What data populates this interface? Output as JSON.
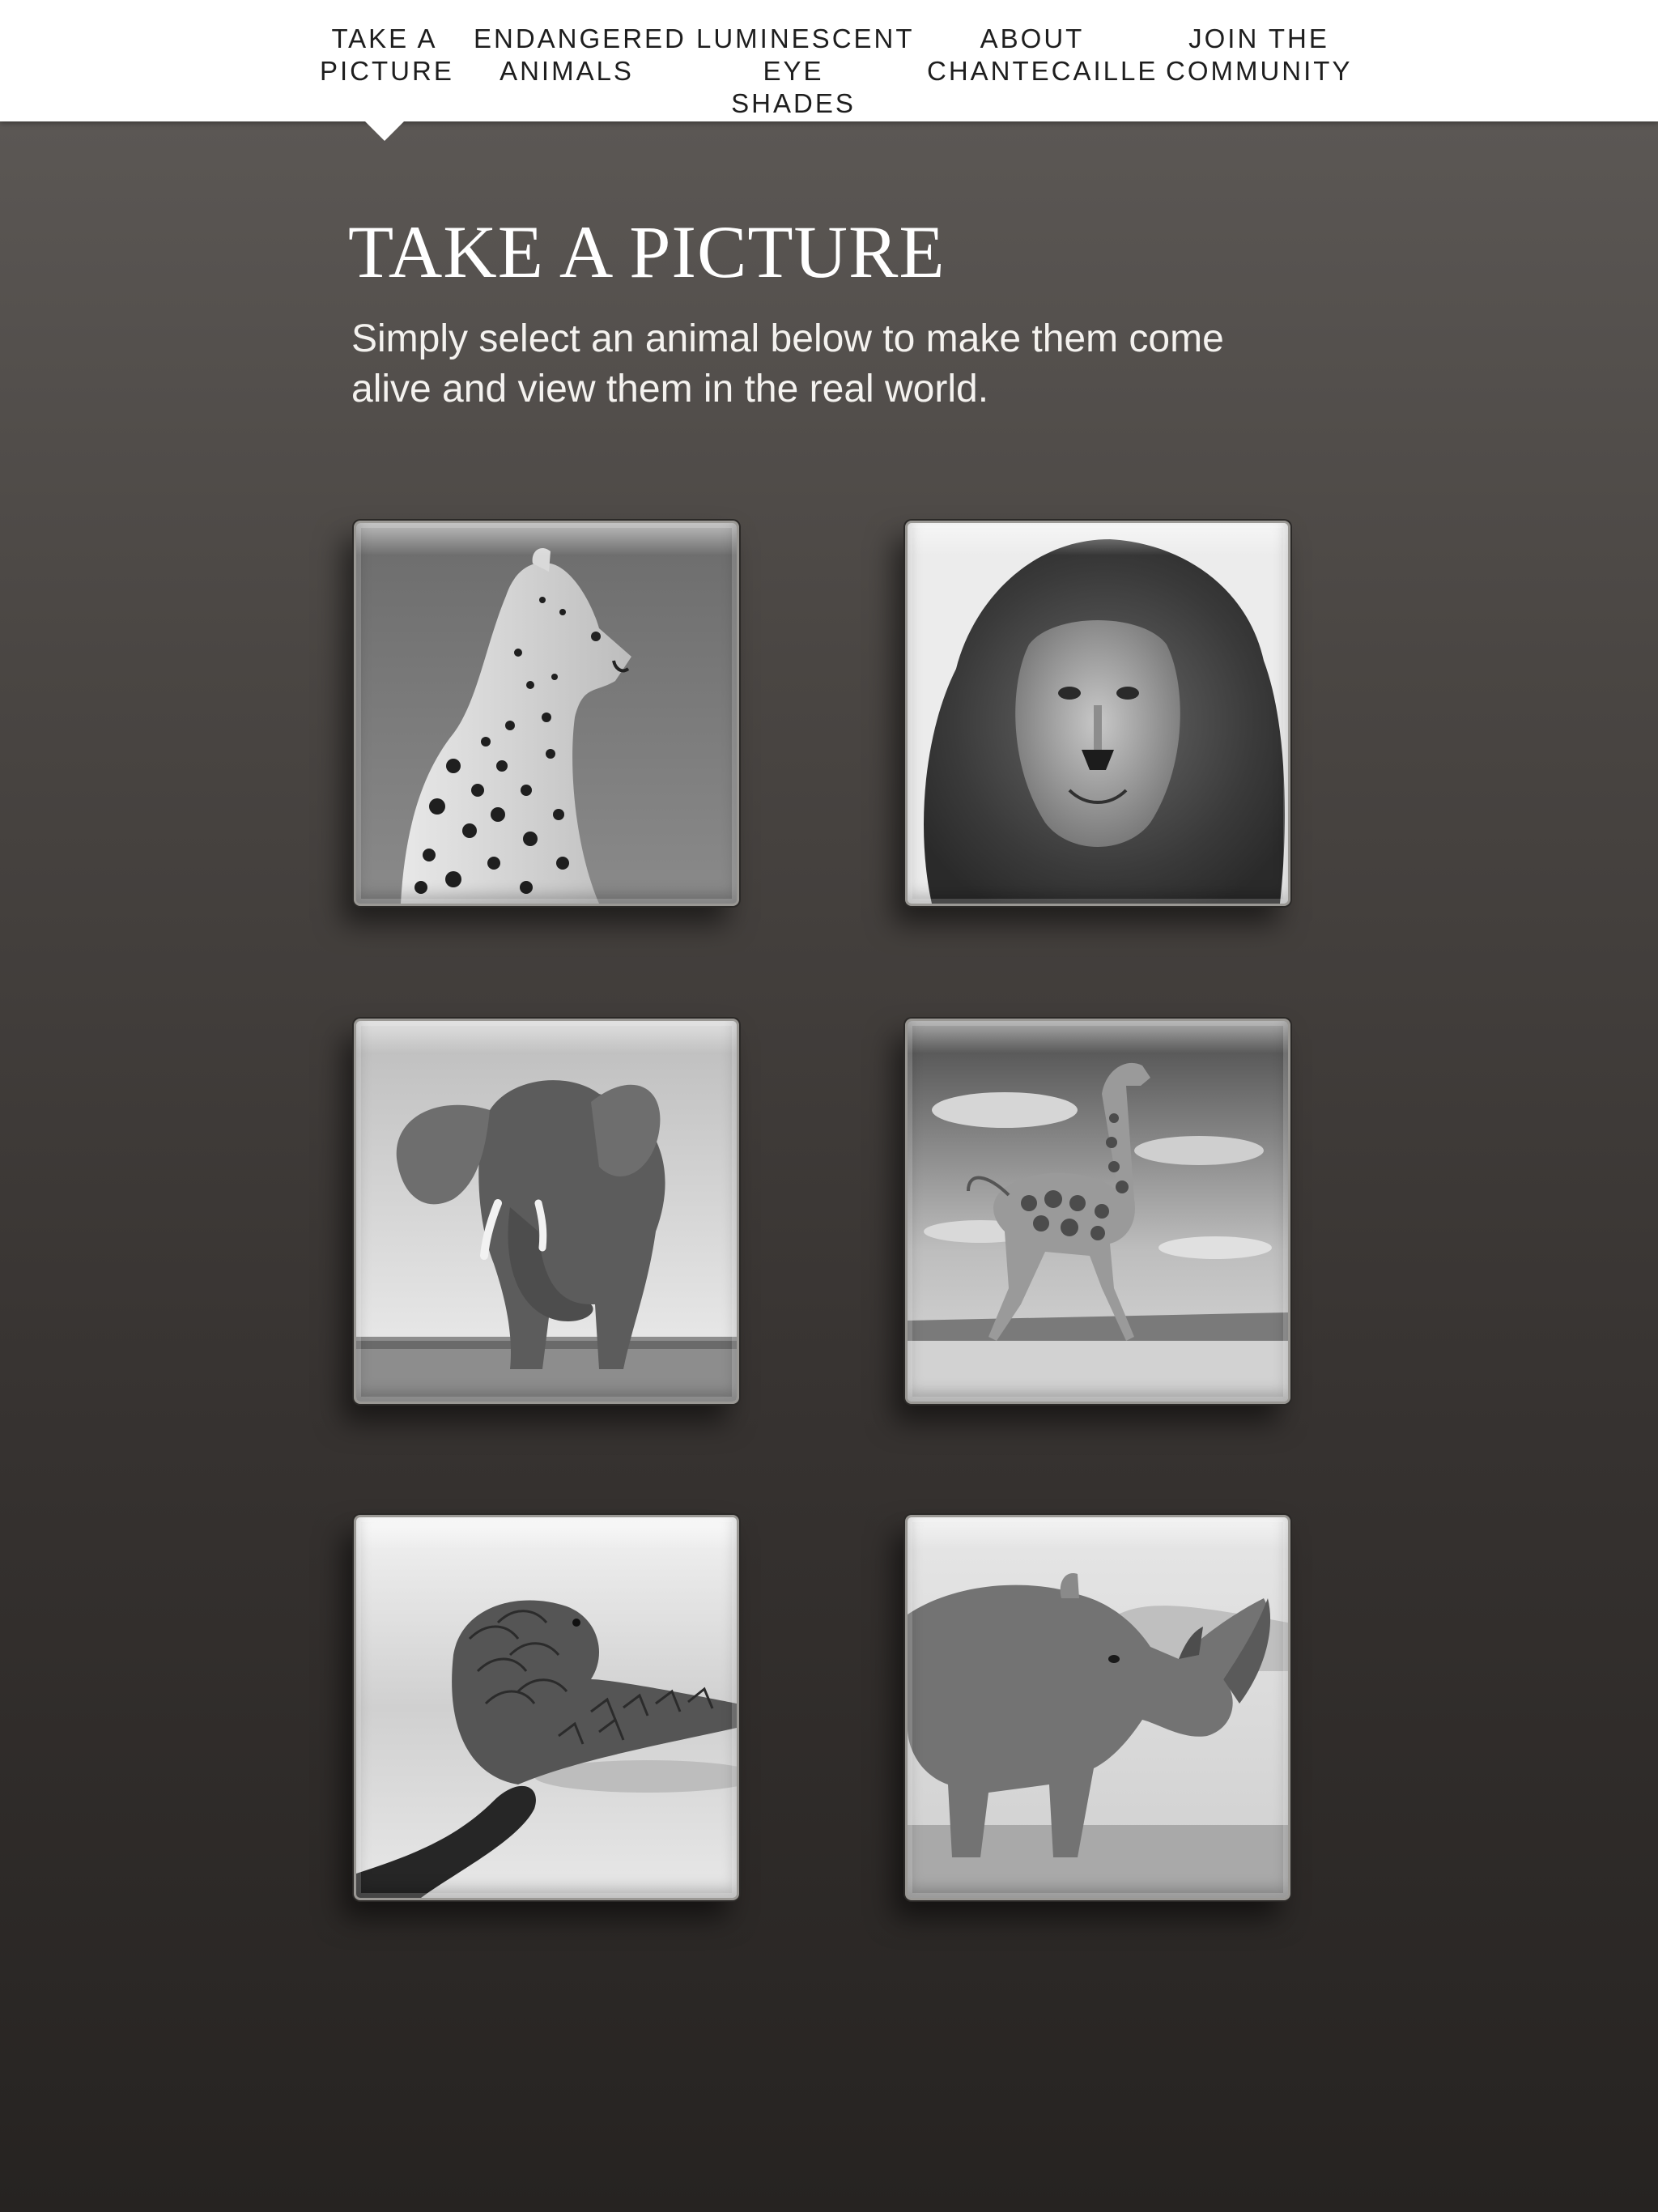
{
  "nav": {
    "items": [
      {
        "line1": "TAKE A",
        "line2": "PICTURE",
        "active": true
      },
      {
        "line1": "ENDANGERED",
        "line2": "ANIMALS",
        "active": false
      },
      {
        "line1": "LUMINESCENT",
        "line2": "EYE SHADES",
        "active": false
      },
      {
        "line1": "ABOUT",
        "line2": "CHANTECAILLE",
        "active": false
      },
      {
        "line1": "JOIN THE",
        "line2": "COMMUNITY",
        "active": false
      }
    ]
  },
  "page": {
    "title": "TAKE A PICTURE",
    "intro_line1": "Simply select an animal below to make them come",
    "intro_line2": "alive and view them in the real world."
  },
  "animals": [
    {
      "name": "cheetah",
      "icon": "cheetah-photo"
    },
    {
      "name": "lion",
      "icon": "lion-photo"
    },
    {
      "name": "elephant",
      "icon": "elephant-photo"
    },
    {
      "name": "giraffe",
      "icon": "giraffe-photo"
    },
    {
      "name": "pangolin",
      "icon": "pangolin-photo"
    },
    {
      "name": "rhino",
      "icon": "rhino-photo"
    }
  ],
  "colors": {
    "nav_background": "#ffffff",
    "nav_text": "#1e1e1e",
    "page_background_top": "#5f5b58",
    "page_background_bottom": "#262321",
    "title_text": "#ffffff"
  }
}
